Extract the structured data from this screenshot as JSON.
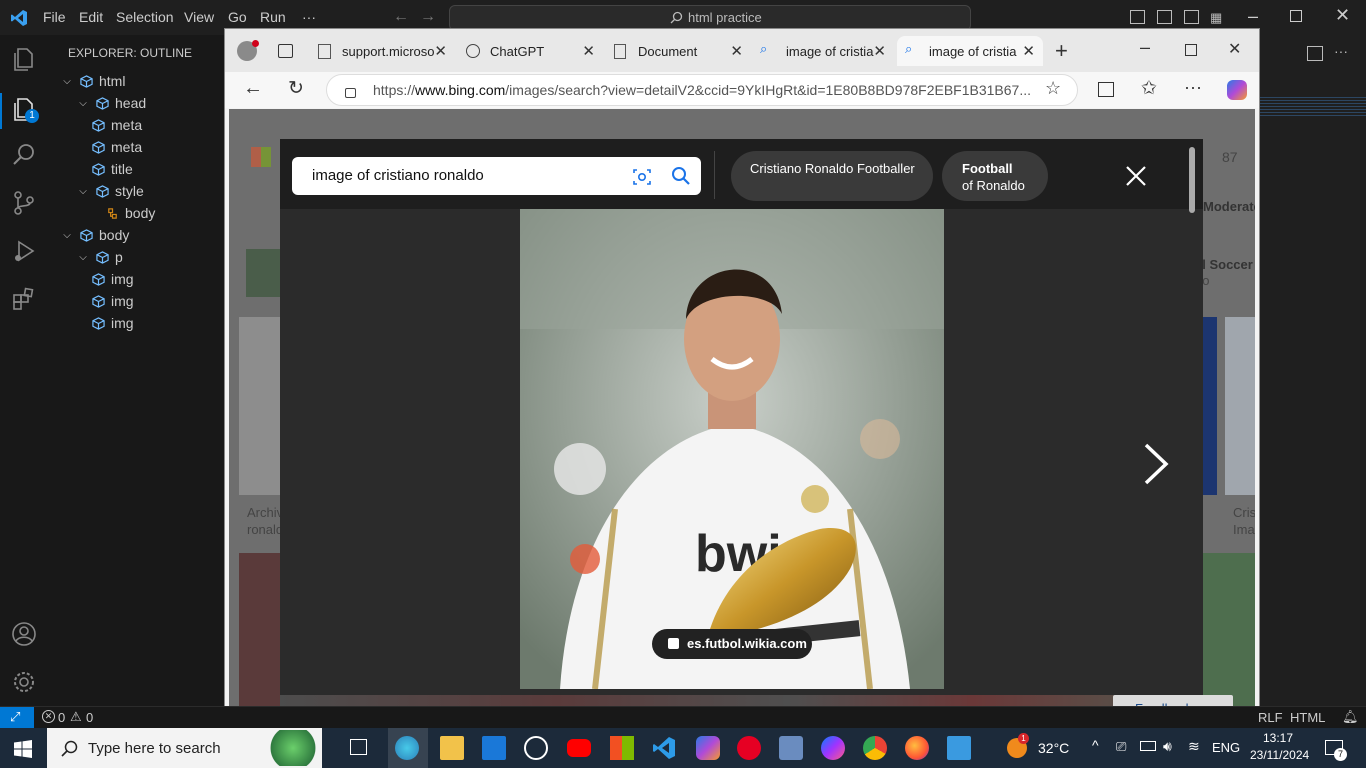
{
  "vscode": {
    "menu": [
      "File",
      "Edit",
      "Selection",
      "View",
      "Go",
      "Run",
      "···"
    ],
    "search_text": "html practice",
    "explorer_title": "EXPLORER: OUTLINE",
    "outline": [
      {
        "label": "html",
        "indent": 0,
        "chev": "⌄",
        "kind": "cube"
      },
      {
        "label": "head",
        "indent": 1,
        "chev": "⌄",
        "kind": "cube"
      },
      {
        "label": "meta",
        "indent": 2,
        "chev": "",
        "kind": "cube"
      },
      {
        "label": "meta",
        "indent": 2,
        "chev": "",
        "kind": "cube"
      },
      {
        "label": "title",
        "indent": 2,
        "chev": "",
        "kind": "cube"
      },
      {
        "label": "style",
        "indent": 1,
        "chev": "⌄",
        "kind": "cube"
      },
      {
        "label": "body",
        "indent": 3,
        "chev": "",
        "kind": "style"
      },
      {
        "label": "body",
        "indent": 0,
        "chev": "⌄",
        "kind": "cube"
      },
      {
        "label": "p",
        "indent": 1,
        "chev": "⌄",
        "kind": "cube"
      },
      {
        "label": "img",
        "indent": 2,
        "chev": "",
        "kind": "cube"
      },
      {
        "label": "img",
        "indent": 2,
        "chev": "",
        "kind": "cube"
      },
      {
        "label": "img",
        "indent": 2,
        "chev": "",
        "kind": "cube"
      }
    ],
    "explorer_badge": "1",
    "status_problems": "0",
    "status_warnings": "0",
    "status_right": [
      "RLF",
      "HTML"
    ]
  },
  "edge": {
    "tabs": [
      {
        "label": "support.microso",
        "icon": "page-icon"
      },
      {
        "label": "ChatGPT",
        "icon": "chatgpt-icon"
      },
      {
        "label": "Document",
        "icon": "doc-icon"
      },
      {
        "label": "image of cristian",
        "icon": "search-icon"
      },
      {
        "label": "image of cristiar",
        "icon": "search-icon",
        "active": true
      }
    ],
    "url_prefix": "https://",
    "url_host": "www.bing.com",
    "url_rest": "/images/search?view=detailV2&ccid=9YkIHgRt&id=1E80B8BD978F2EBF1B31B67..."
  },
  "bing": {
    "query": "image of cristiano ronaldo",
    "chip1": "Cristiano Ronaldo Footballer",
    "chip2_bold": "Football",
    "chip2_sub": "of Ronaldo",
    "source": "es.futbol.wikia.com",
    "bg_count": "87",
    "bg_moderate": "Moderate",
    "bg_soccer1": "al Soccer",
    "bg_soccer2": "do",
    "bg_archive1": "Archiv",
    "bg_archive2": "ronald",
    "bg_cris1": "Cris",
    "bg_cris2": "Ima",
    "feedback": "Feedback"
  },
  "taskbar": {
    "search_placeholder": "Type here to search",
    "temperature": "32°C",
    "language": "ENG",
    "time": "13:17",
    "date": "23/11/2024",
    "notif_count": "7",
    "weather_badge": "1"
  },
  "colors": {
    "vscode_bg": "#1f1f1f",
    "accent": "#0078d4",
    "taskbar": "#1c2a3a"
  }
}
